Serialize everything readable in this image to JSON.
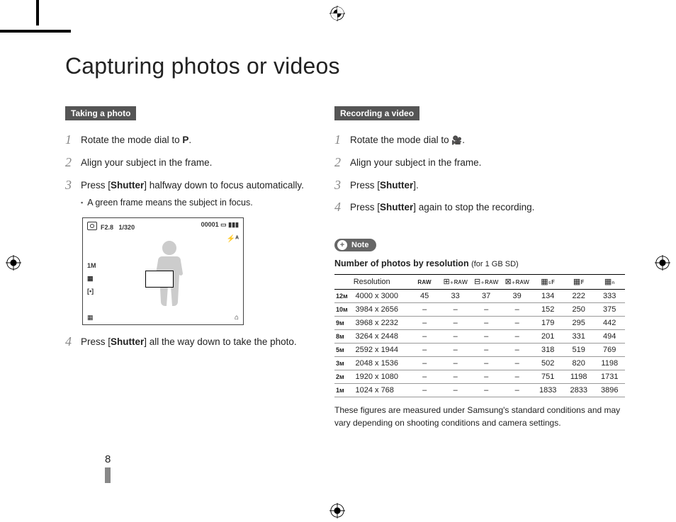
{
  "page_title": "Capturing photos or videos",
  "page_number": "8",
  "photo_section": {
    "tag": "Taking a photo",
    "steps": [
      {
        "n": "1",
        "text_pre": "Rotate the mode dial to ",
        "icon": "P",
        "text_post": "."
      },
      {
        "n": "2",
        "text_pre": "Align your subject in the frame.",
        "icon": "",
        "text_post": ""
      },
      {
        "n": "3",
        "text_pre": "Press [",
        "bold": "Shutter",
        "text_post": "] halfway down to focus automatically.",
        "sub": "A green frame means the subject in focus."
      },
      {
        "n": "4",
        "text_pre": "Press [",
        "bold": "Shutter",
        "text_post": "] all the way down to take the photo."
      }
    ],
    "lcd": {
      "aperture": "F2.8",
      "shutter": "1/320",
      "counter": "00001",
      "res_icon": "1M",
      "meter_icon": "[•]",
      "flash": "⚡ᴬ"
    }
  },
  "video_section": {
    "tag": "Recording a video",
    "steps": [
      {
        "n": "1",
        "text_pre": "Rotate the mode dial to ",
        "icon": "🎥",
        "text_post": "."
      },
      {
        "n": "2",
        "text_pre": "Align your subject in the frame.",
        "icon": "",
        "text_post": ""
      },
      {
        "n": "3",
        "text_pre": "Press [",
        "bold": "Shutter",
        "text_post": "]."
      },
      {
        "n": "4",
        "text_pre": "Press [",
        "bold": "Shutter",
        "text_post": "] again to stop the recording."
      }
    ]
  },
  "note": {
    "pill": "Note",
    "title_bold": "Number of photos by resolution",
    "title_paren": "(for 1 GB SD)",
    "header_res": "Resolution",
    "header_icons": [
      "RAW",
      "⊞₊ʀᴀᴡ",
      "⊟₊ʀᴀᴡ",
      "⊠₊ʀᴀᴡ",
      "▦ₛꜰ",
      "▦ꜰ",
      "▦ₙ"
    ],
    "rows": [
      {
        "size": "12ᴍ",
        "dim": "4000 x 3000",
        "v": [
          "45",
          "33",
          "37",
          "39",
          "134",
          "222",
          "333"
        ]
      },
      {
        "size": "10ᴍ",
        "dim": "3984 x 2656",
        "v": [
          "–",
          "–",
          "–",
          "–",
          "152",
          "250",
          "375"
        ]
      },
      {
        "size": "9ᴍ",
        "dim": "3968 x 2232",
        "v": [
          "–",
          "–",
          "–",
          "–",
          "179",
          "295",
          "442"
        ]
      },
      {
        "size": "8ᴍ",
        "dim": "3264 x 2448",
        "v": [
          "–",
          "–",
          "–",
          "–",
          "201",
          "331",
          "494"
        ]
      },
      {
        "size": "5ᴍ",
        "dim": "2592 x 1944",
        "v": [
          "–",
          "–",
          "–",
          "–",
          "318",
          "519",
          "769"
        ]
      },
      {
        "size": "3ᴍ",
        "dim": "2048 x 1536",
        "v": [
          "–",
          "–",
          "–",
          "–",
          "502",
          "820",
          "1198"
        ]
      },
      {
        "size": "2ᴍ",
        "dim": "1920 x 1080",
        "v": [
          "–",
          "–",
          "–",
          "–",
          "751",
          "1198",
          "1731"
        ]
      },
      {
        "size": "1ᴍ",
        "dim": "1024 x 768",
        "v": [
          "–",
          "–",
          "–",
          "–",
          "1833",
          "2833",
          "3896"
        ]
      }
    ],
    "footer": "These figures are measured under Samsung's standard conditions and may vary depending on shooting conditions and camera settings."
  }
}
